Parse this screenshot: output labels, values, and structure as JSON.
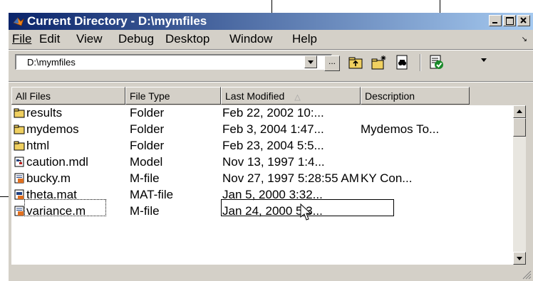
{
  "window": {
    "title": "Current Directory - D:\\mymfiles",
    "brand_color": "#0a246a"
  },
  "menu": [
    "File",
    "Edit",
    "View",
    "Debug",
    "Desktop",
    "Window",
    "Help"
  ],
  "toolbar": {
    "path_value": "D:\\mymfiles",
    "browse_label": "...",
    "icons": [
      "up-folder-icon",
      "new-folder-icon",
      "find-icon",
      "run-check-icon"
    ]
  },
  "columns": [
    "All Files",
    "File Type",
    "Last Modified",
    "Description"
  ],
  "sorted_column": "Last Modified",
  "files": [
    {
      "name": "results",
      "type": "Folder",
      "modified": "Feb 22, 2002 10:...",
      "description": "",
      "icon": "folder-icon"
    },
    {
      "name": "mydemos",
      "type": "Folder",
      "modified": "Feb 3, 2004 1:47...",
      "description": "Mydemos To...",
      "icon": "folder-icon"
    },
    {
      "name": "html",
      "type": "Folder",
      "modified": "Feb 23, 2004 5:5...",
      "description": "",
      "icon": "folder-icon"
    },
    {
      "name": "caution.mdl",
      "type": "Model",
      "modified": "Nov 13, 1997 1:4...",
      "description": "",
      "icon": "model-file-icon"
    },
    {
      "name": "bucky.m",
      "type": "M-file",
      "modified": "Nov 27, 1997 5:28:55 AM",
      "description": "KY  Con...",
      "icon": "m-file-icon"
    },
    {
      "name": "theta.mat",
      "type": "MAT-file",
      "modified": "Jan 5, 2000 3:32...",
      "description": "",
      "icon": "mat-file-icon"
    },
    {
      "name": "variance.m",
      "type": "M-file",
      "modified": "Jan 24, 2000 5:3...",
      "description": "",
      "icon": "m-file-icon"
    }
  ]
}
